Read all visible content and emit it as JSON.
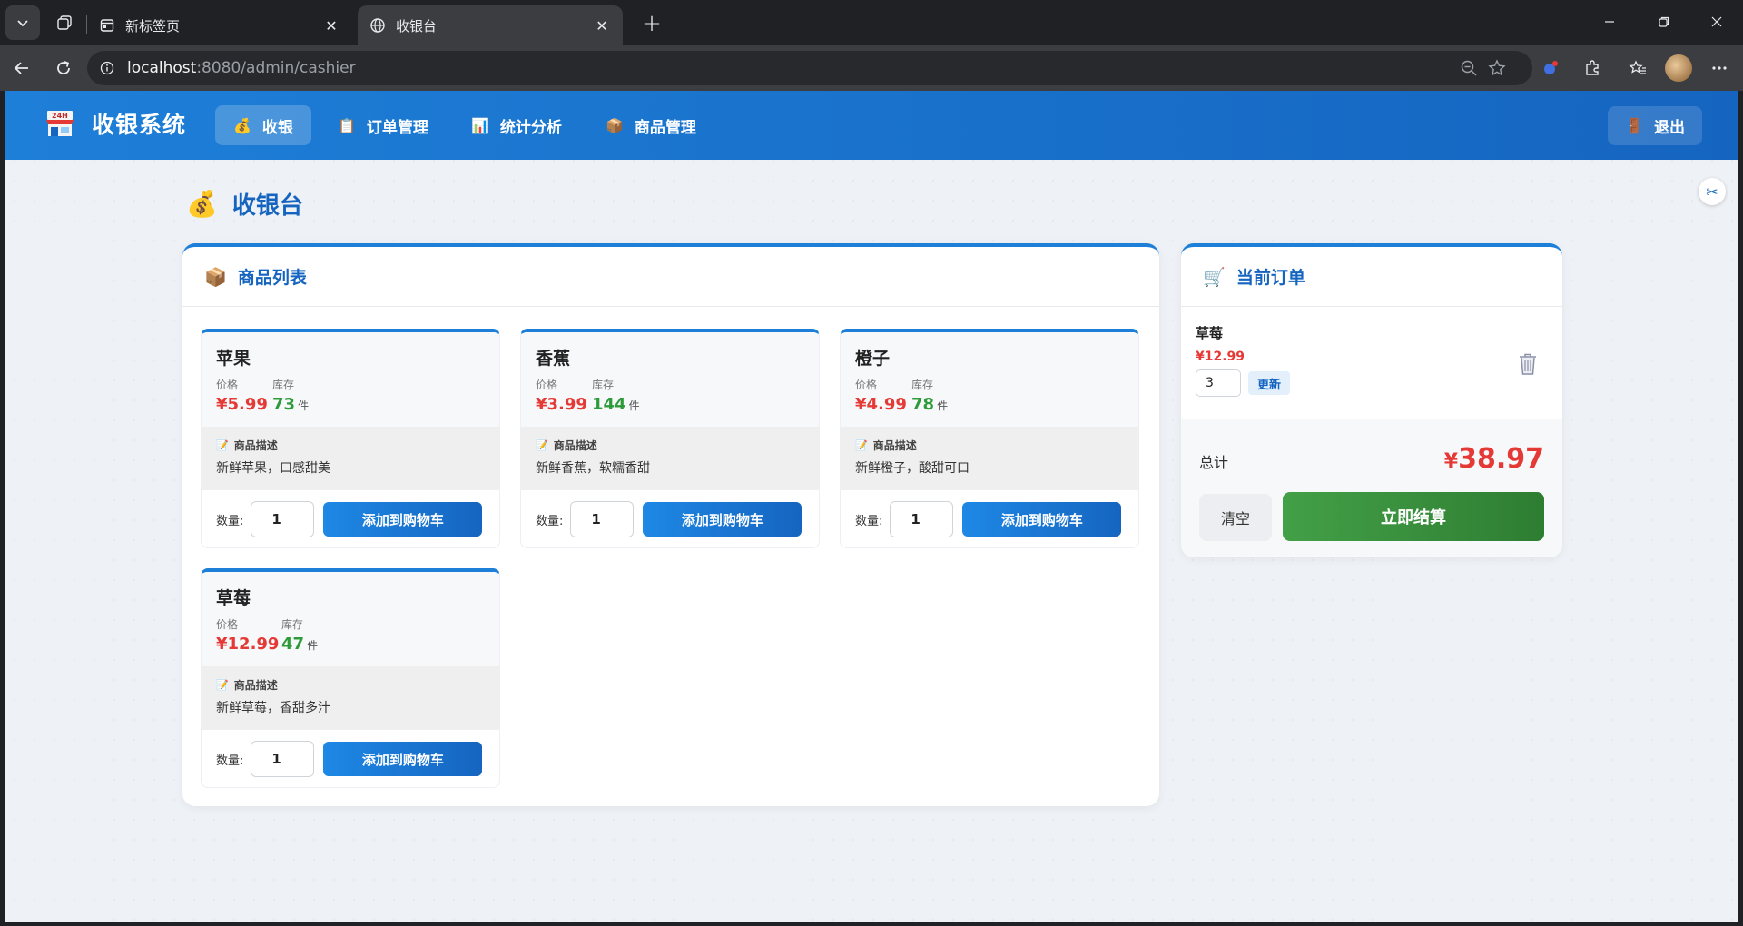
{
  "browser": {
    "tabs": [
      {
        "title": "新标签页",
        "active": false
      },
      {
        "title": "收银台",
        "active": true
      }
    ],
    "url_host": "localhost",
    "url_rest": ":8080/admin/cashier"
  },
  "app": {
    "brand": "收银系统",
    "nav": [
      {
        "icon": "💰",
        "label": "收银",
        "active": true
      },
      {
        "icon": "📋",
        "label": "订单管理",
        "active": false
      },
      {
        "icon": "📊",
        "label": "统计分析",
        "active": false
      },
      {
        "icon": "📦",
        "label": "商品管理",
        "active": false
      }
    ],
    "logout": "退出",
    "logout_icon": "🚪"
  },
  "page": {
    "icon": "💰",
    "title": "收银台"
  },
  "products_panel": {
    "icon": "📦",
    "title": "商品列表",
    "price_label": "价格",
    "stock_label": "库存",
    "unit": "件",
    "desc_label": "商品描述",
    "qty_label": "数量:",
    "add_label": "添加到购物车",
    "items": [
      {
        "name": "苹果",
        "price": "¥5.99",
        "stock": "73",
        "desc": "新鲜苹果，口感甜美",
        "qty": "1"
      },
      {
        "name": "香蕉",
        "price": "¥3.99",
        "stock": "144",
        "desc": "新鲜香蕉，软糯香甜",
        "qty": "1"
      },
      {
        "name": "橙子",
        "price": "¥4.99",
        "stock": "78",
        "desc": "新鲜橙子，酸甜可口",
        "qty": "1"
      },
      {
        "name": "草莓",
        "price": "¥12.99",
        "stock": "47",
        "desc": "新鲜草莓，香甜多汁",
        "qty": "1"
      }
    ]
  },
  "order_panel": {
    "icon": "🛒",
    "title": "当前订单",
    "items": [
      {
        "name": "草莓",
        "price": "¥12.99",
        "qty": "3",
        "update_label": "更新"
      }
    ],
    "total_label": "总计",
    "total_currency": "¥",
    "total_value": "38.97",
    "clear_label": "清空",
    "checkout_label": "立即结算"
  },
  "colors": {
    "primary": "#1565c0",
    "price_red": "#e53935",
    "stock_green": "#2e9b3a",
    "checkout_green": "#43a047"
  }
}
